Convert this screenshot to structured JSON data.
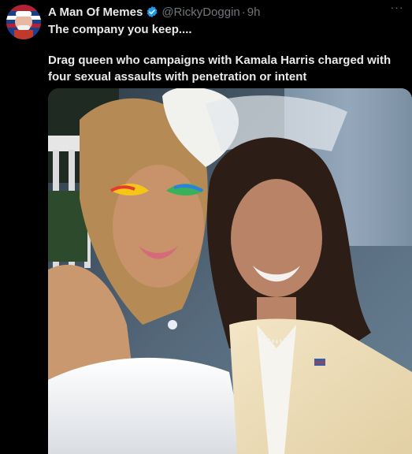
{
  "author": {
    "display_name": "A Man Of Memes",
    "handle": "@RickyDoggin",
    "separator": "·",
    "time": "9h"
  },
  "tweet": {
    "line1": "The company you keep....",
    "line2": "Drag queen who campaigns with Kamala Harris charged with four sexual assaults with penetration or intent"
  },
  "icons": {
    "verified": "verified-badge-icon",
    "more": "more-options-icon"
  },
  "colors": {
    "background": "#000000",
    "text_primary": "#e7e9ea",
    "text_secondary": "#71767b",
    "verified_blue": "#1d9bf0"
  }
}
